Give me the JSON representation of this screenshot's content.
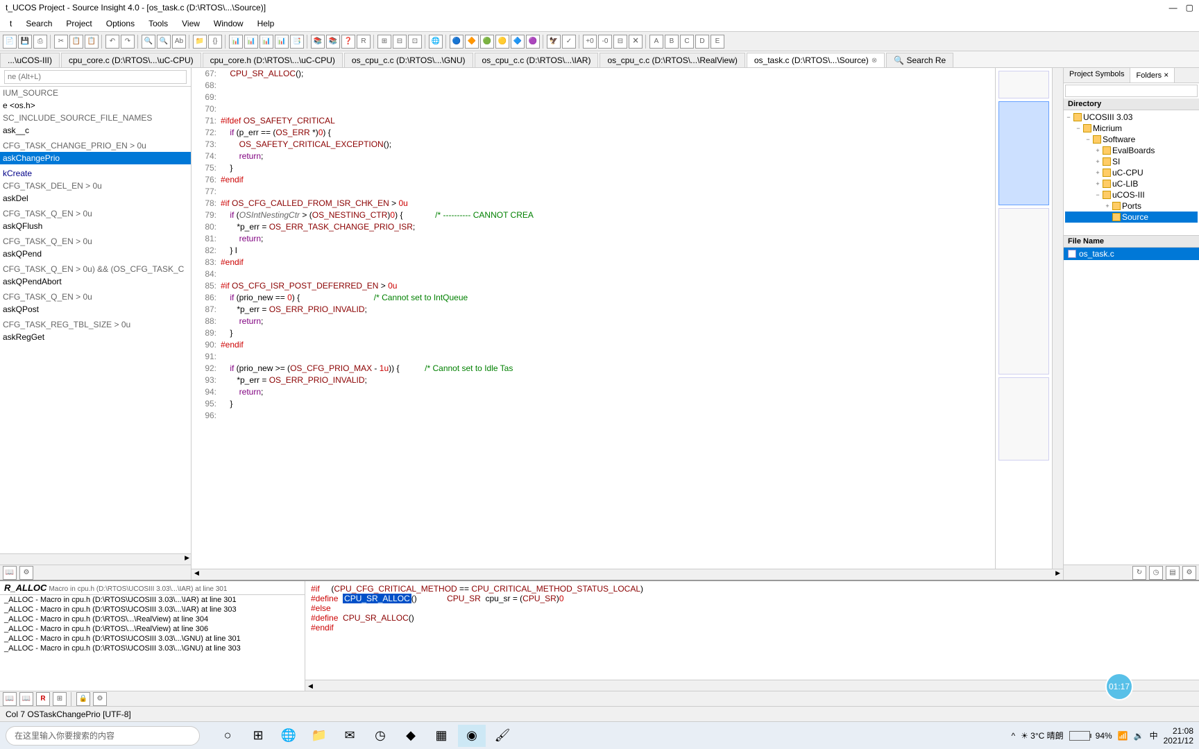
{
  "window": {
    "title": "t_UCOS Project - Source Insight 4.0 - [os_task.c (D:\\RTOS\\...\\Source)]",
    "min": "—",
    "max": "▢"
  },
  "menu": [
    "t",
    "Search",
    "Project",
    "Options",
    "Tools",
    "View",
    "Window",
    "Help"
  ],
  "tabs": [
    {
      "label": "...\\uCOS-III)",
      "active": false
    },
    {
      "label": "cpu_core.c (D:\\RTOS\\...\\uC-CPU)",
      "active": false
    },
    {
      "label": "cpu_core.h (D:\\RTOS\\...\\uC-CPU)",
      "active": false
    },
    {
      "label": "os_cpu_c.c (D:\\RTOS\\...\\GNU)",
      "active": false
    },
    {
      "label": "os_cpu_c.c (D:\\RTOS\\...\\IAR)",
      "active": false
    },
    {
      "label": "os_cpu_c.c (D:\\RTOS\\...\\RealView)",
      "active": false
    },
    {
      "label": "os_task.c (D:\\RTOS\\...\\Source)",
      "active": true,
      "closable": true
    },
    {
      "label": "🔍 Search Re",
      "active": false
    }
  ],
  "search_placeholder": "ne (Alt+L)",
  "symbols": [
    {
      "t": "IUM_SOURCE",
      "cls": "gray"
    },
    {
      "t": "e <os.h>",
      "cls": ""
    },
    {
      "t": "SC_INCLUDE_SOURCE_FILE_NAMES",
      "cls": "gray"
    },
    {
      "t": "ask__c",
      "cls": ""
    },
    {
      "t": "",
      "cls": ""
    },
    {
      "t": "CFG_TASK_CHANGE_PRIO_EN > 0u",
      "cls": "gray"
    },
    {
      "t": "askChangePrio",
      "cls": "selected"
    },
    {
      "t": "",
      "cls": ""
    },
    {
      "t": "kCreate",
      "cls": "fn"
    },
    {
      "t": "CFG_TASK_DEL_EN > 0u",
      "cls": "gray"
    },
    {
      "t": "askDel",
      "cls": ""
    },
    {
      "t": "",
      "cls": ""
    },
    {
      "t": "CFG_TASK_Q_EN > 0u",
      "cls": "gray"
    },
    {
      "t": "askQFlush",
      "cls": ""
    },
    {
      "t": "",
      "cls": ""
    },
    {
      "t": "CFG_TASK_Q_EN > 0u",
      "cls": "gray"
    },
    {
      "t": "askQPend",
      "cls": ""
    },
    {
      "t": "",
      "cls": ""
    },
    {
      "t": "CFG_TASK_Q_EN > 0u) && (OS_CFG_TASK_C",
      "cls": "gray"
    },
    {
      "t": "askQPendAbort",
      "cls": ""
    },
    {
      "t": "",
      "cls": ""
    },
    {
      "t": "CFG_TASK_Q_EN > 0u",
      "cls": "gray"
    },
    {
      "t": "askQPost",
      "cls": ""
    },
    {
      "t": "",
      "cls": ""
    },
    {
      "t": "CFG_TASK_REG_TBL_SIZE > 0u",
      "cls": "gray"
    },
    {
      "t": "askRegGet",
      "cls": ""
    }
  ],
  "code": [
    {
      "n": "67",
      "html": "    <span class='mc'>CPU_SR_ALLOC</span>();"
    },
    {
      "n": "68",
      "html": ""
    },
    {
      "n": "69",
      "html": ""
    },
    {
      "n": "70",
      "html": ""
    },
    {
      "n": "71",
      "html": "<span class='pp'>#ifdef</span> <span class='mc'>OS_SAFETY_CRITICAL</span>"
    },
    {
      "n": "72",
      "html": "    <span class='k'>if</span> (p_err == (<span class='mc'>OS_ERR</span> *)<span class='num'>0</span>) {"
    },
    {
      "n": "73",
      "html": "        <span class='mc'>OS_SAFETY_CRITICAL_EXCEPTION</span>();"
    },
    {
      "n": "74",
      "html": "        <span class='k'>return</span>;"
    },
    {
      "n": "75",
      "html": "    }"
    },
    {
      "n": "76",
      "html": "<span class='pp'>#endif</span>"
    },
    {
      "n": "77",
      "html": ""
    },
    {
      "n": "78",
      "html": "<span class='pp'>#if</span> <span class='mc'>OS_CFG_CALLED_FROM_ISR_CHK_EN</span> &gt; <span class='num'>0u</span>"
    },
    {
      "n": "79",
      "html": "    <span class='k'>if</span> (<span class='it'>OSIntNestingCtr</span> &gt; (<span class='mc'>OS_NESTING_CTR</span>)<span class='num'>0</span>) {              <span class='cm'>/* ---------- CANNOT CREA</span>"
    },
    {
      "n": "80",
      "html": "       *p_err = <span class='mc'>OS_ERR_TASK_CHANGE_PRIO_ISR</span>;"
    },
    {
      "n": "81",
      "html": "        <span class='k'>return</span>;"
    },
    {
      "n": "82",
      "html": "    } I"
    },
    {
      "n": "83",
      "html": "<span class='pp'>#endif</span>"
    },
    {
      "n": "84",
      "html": ""
    },
    {
      "n": "85",
      "html": "<span class='pp'>#if</span> <span class='mc'>OS_CFG_ISR_POST_DEFERRED_EN</span> &gt; <span class='num'>0u</span>"
    },
    {
      "n": "86",
      "html": "    <span class='k'>if</span> (prio_new == <span class='num'>0</span>) {                                <span class='cm'>/* Cannot set to IntQueue</span>"
    },
    {
      "n": "87",
      "html": "       *p_err = <span class='mc'>OS_ERR_PRIO_INVALID</span>;"
    },
    {
      "n": "88",
      "html": "        <span class='k'>return</span>;"
    },
    {
      "n": "89",
      "html": "    }"
    },
    {
      "n": "90",
      "html": "<span class='pp'>#endif</span>"
    },
    {
      "n": "91",
      "html": ""
    },
    {
      "n": "92",
      "html": "    <span class='k'>if</span> (prio_new &gt;= (<span class='mc'>OS_CFG_PRIO_MAX</span> - <span class='num'>1u</span>)) {           <span class='cm'>/* Cannot set to Idle Tas</span>"
    },
    {
      "n": "93",
      "html": "       *p_err = <span class='mc'>OS_ERR_PRIO_INVALID</span>;"
    },
    {
      "n": "94",
      "html": "        <span class='k'>return</span>;"
    },
    {
      "n": "95",
      "html": "    }"
    },
    {
      "n": "96",
      "html": ""
    }
  ],
  "right": {
    "tabs": [
      {
        "t": "Project Symbols"
      },
      {
        "t": "Folders",
        "active": true,
        "close": true
      }
    ],
    "dir_hdr": "Directory",
    "tree": [
      {
        "ind": 0,
        "exp": "−",
        "t": "UCOSIII 3.03"
      },
      {
        "ind": 1,
        "exp": "−",
        "t": "Micrium"
      },
      {
        "ind": 2,
        "exp": "−",
        "t": "Software"
      },
      {
        "ind": 3,
        "exp": "+",
        "t": "EvalBoards"
      },
      {
        "ind": 3,
        "exp": "+",
        "t": "SI"
      },
      {
        "ind": 3,
        "exp": "+",
        "t": "uC-CPU"
      },
      {
        "ind": 3,
        "exp": "+",
        "t": "uC-LIB"
      },
      {
        "ind": 3,
        "exp": "−",
        "t": "uCOS-III"
      },
      {
        "ind": 4,
        "exp": "+",
        "t": "Ports"
      },
      {
        "ind": 4,
        "exp": "",
        "t": "Source",
        "sel": true
      }
    ],
    "file_hdr": "File Name",
    "file": "os_task.c"
  },
  "ctx": {
    "hdr_sym": "R_ALLOC",
    "hdr_loc": "Macro in cpu.h (D:\\RTOS\\UCOSIII 3.03\\...\\IAR) at line 301",
    "refs": [
      "_ALLOC - Macro in cpu.h (D:\\RTOS\\UCOSIII 3.03\\...\\IAR) at line 301",
      "_ALLOC - Macro in cpu.h (D:\\RTOS\\UCOSIII 3.03\\...\\IAR) at line 303",
      "_ALLOC - Macro in cpu.h (D:\\RTOS\\...\\RealView) at line 304",
      "_ALLOC - Macro in cpu.h (D:\\RTOS\\...\\RealView) at line 306",
      "_ALLOC - Macro in cpu.h (D:\\RTOS\\UCOSIII 3.03\\...\\GNU) at line 301",
      "_ALLOC - Macro in cpu.h (D:\\RTOS\\UCOSIII 3.03\\...\\GNU) at line 303"
    ],
    "code": [
      "<span class='pp'>#if</span>     (<span class='mc'>CPU_CFG_CRITICAL_METHOD</span> == <span class='mc'>CPU_CRITICAL_METHOD_STATUS_LOCAL</span>)",
      "<span class='pp'>#define</span>  <span class='hl'>CPU_SR_ALLOC</span>()             <span class='mc'>CPU_SR</span>  cpu_sr = (<span class='mc'>CPU_SR</span>)<span class='num'>0</span>",
      "<span class='pp'>#else</span>",
      "<span class='pp'>#define</span>  <span class='mc'>CPU_SR_ALLOC</span>()",
      "<span class='pp'>#endif</span>"
    ]
  },
  "status": "Col 7  OSTaskChangePrio [UTF-8]",
  "taskbar": {
    "search": "在这里输入你要搜索的内容",
    "weather": "3°C 晴朗",
    "battery": "94%",
    "ime": "中",
    "time": "21:08",
    "date": "2021/12"
  },
  "badge": "01:17"
}
